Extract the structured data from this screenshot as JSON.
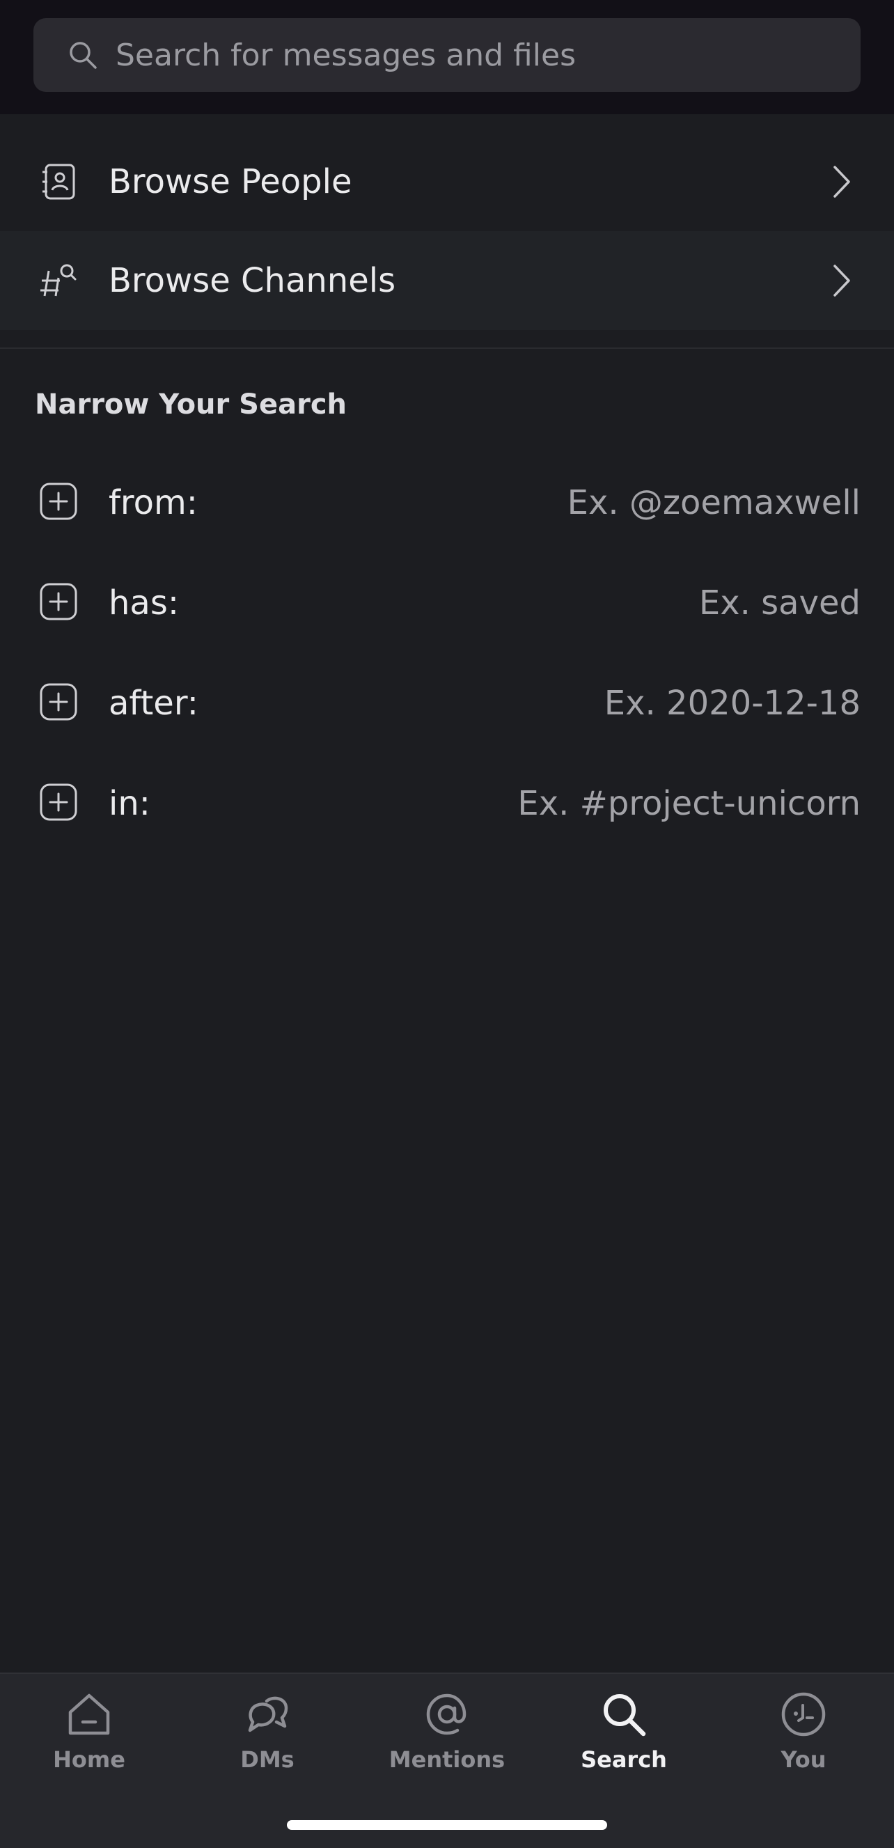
{
  "search": {
    "placeholder": "Search for messages and files"
  },
  "browse": {
    "people_label": "Browse People",
    "channels_label": "Browse Channels"
  },
  "narrow": {
    "title": "Narrow Your Search",
    "filters": [
      {
        "key": "from:",
        "example": "Ex. @zoemaxwell"
      },
      {
        "key": "has:",
        "example": "Ex. saved"
      },
      {
        "key": "after:",
        "example": "Ex. 2020-12-18"
      },
      {
        "key": "in:",
        "example": "Ex. #project-unicorn"
      }
    ]
  },
  "tabs": [
    {
      "label": "Home",
      "icon": "home-icon",
      "active": false
    },
    {
      "label": "DMs",
      "icon": "dms-icon",
      "active": false
    },
    {
      "label": "Mentions",
      "icon": "at-icon",
      "active": false
    },
    {
      "label": "Search",
      "icon": "search-icon",
      "active": true
    },
    {
      "label": "You",
      "icon": "you-icon",
      "active": false
    }
  ],
  "colors": {
    "background": "#1c1d21",
    "header": "#121017",
    "tabbar": "#26272c",
    "active_tab": "#f2f2f4",
    "inactive_tab": "#8e8e94"
  }
}
